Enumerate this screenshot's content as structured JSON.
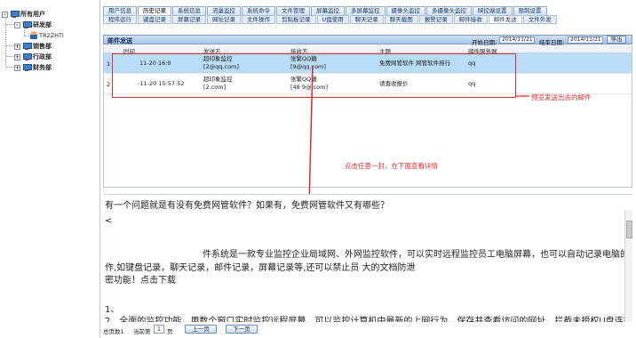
{
  "tree": {
    "root": "所有用户",
    "dept1": "研发部",
    "user1": "TR2ZHTI",
    "dept2": "销售部",
    "dept3": "行政部",
    "dept4": "财务部"
  },
  "tabs_top": [
    "用户信息",
    "历史记录",
    "系统信息",
    "流量监控",
    "系统命令",
    "文件管理",
    "屏幕监控",
    "多屏幕监控",
    "摄像头监控",
    "多摄像头监控",
    "映控端设置",
    "限制设置"
  ],
  "tabs_top_active": 1,
  "tabs_sub": [
    "程序运行",
    "键盘记录",
    "屏幕记录",
    "网址记录",
    "文件操作",
    "剪贴板记录",
    "U盘使用",
    "聊天记录",
    "聊天截图",
    "报警记录",
    "邮件接收",
    "邮件发送",
    "文件外发"
  ],
  "tabs_sub_active": 11,
  "panel": {
    "title": "邮件发送",
    "start_label": "开始日期:",
    "start_value": "2014/11/21",
    "end_label": "结束日期:",
    "end_value": "2014/11/21",
    "export_label": "导出"
  },
  "table": {
    "headers": {
      "time": "时间",
      "sender": "发送方",
      "receiver": "接收方",
      "subject": "主题",
      "server": "邮件服务器"
    },
    "rows": [
      {
        "num": "1",
        "time": "11-20 16:0",
        "sender1": "超印象监控",
        "sender2": "[2@qq.com]",
        "receiver1": "张繁QQ糖",
        "receiver2": "[9@qq.com]",
        "subject": "免费网管软件 网管软件排行",
        "server": "qq"
      },
      {
        "num": "2",
        "time": "-11-20 15:57:52",
        "sender1": "超印象监控",
        "sender2": "[2.com]",
        "receiver1": "张繁QQ糖",
        "receiver2": "[48 9@ com]",
        "subject": "请查收报价",
        "server": "qq"
      }
    ]
  },
  "annotations": {
    "preview": "预览发送出去的邮件",
    "click_hint": "点击任意一封，在下面查看详情"
  },
  "content_lines": [
    "有一个问题就是有没有免费网管软件？如果有，免费网管软件又有哪些？",
    "<",
    "件系统是一款专业监控企业局域网、外网监控软件，可以实时远程监控员工电脑屏幕，也可以自动记录电脑的各种操",
    "作,如键盘记录，聊天记录，邮件记录，屏幕记录等,还可以禁止员                         大的文档防泄",
    "密功能！点击下载",
    "1、",
    "2、全面的监控功能，用数个窗口实时监控远程屏幕，可以监控计算机中最新的上网行为，保存并查看访问的网址，拦截未授权U盘连接"
  ],
  "footer": {
    "total_label": "总页数1",
    "current_label": "当前第",
    "page_value": "1",
    "page_suffix": "页",
    "prev_label": "上一页",
    "next_label": "下一页"
  }
}
